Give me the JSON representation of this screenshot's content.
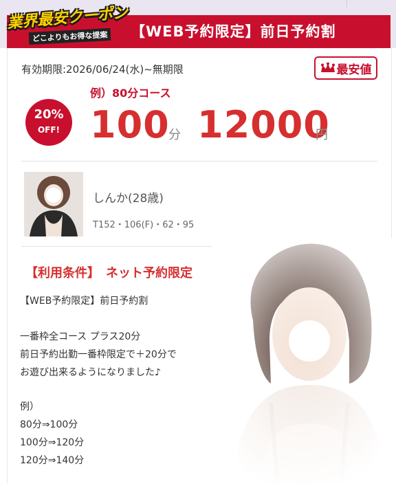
{
  "header": {
    "badge_main": "業界最安クーポン",
    "badge_sub": "どこよりもお得な提案",
    "title": "【WEB予約限定】前日予約割"
  },
  "coupon": {
    "validity": "有効期限:2026/06/24(水)~無期限",
    "cheapest_label": "最安値",
    "discount_percent": "20%",
    "discount_off": "OFF!",
    "course_example": "例）80分コース",
    "minutes": "100",
    "minutes_unit": "分",
    "price": "12000",
    "price_unit": "円"
  },
  "profile": {
    "name": "しんか(28歳)",
    "stats": "T152・106(F)・62・95"
  },
  "conditions": {
    "heading": "【利用条件】　ネット予約限定",
    "lines": [
      "【WEB予約限定】前日予約割",
      "一番枠全コース プラス20分",
      "前日予約出勤一番枠限定で＋20分で",
      "お遊び出来るようになりました♪",
      "例）",
      "80分⇒100分",
      "100分⇒120分",
      "120分⇒140分"
    ]
  },
  "colors": {
    "brand_red": "#c8102e",
    "price_red": "#d62f2f",
    "badge_yellow": "#ffd200",
    "top_band": "#e9e6f1"
  },
  "icons": {
    "cheapest": "crown-icon"
  }
}
